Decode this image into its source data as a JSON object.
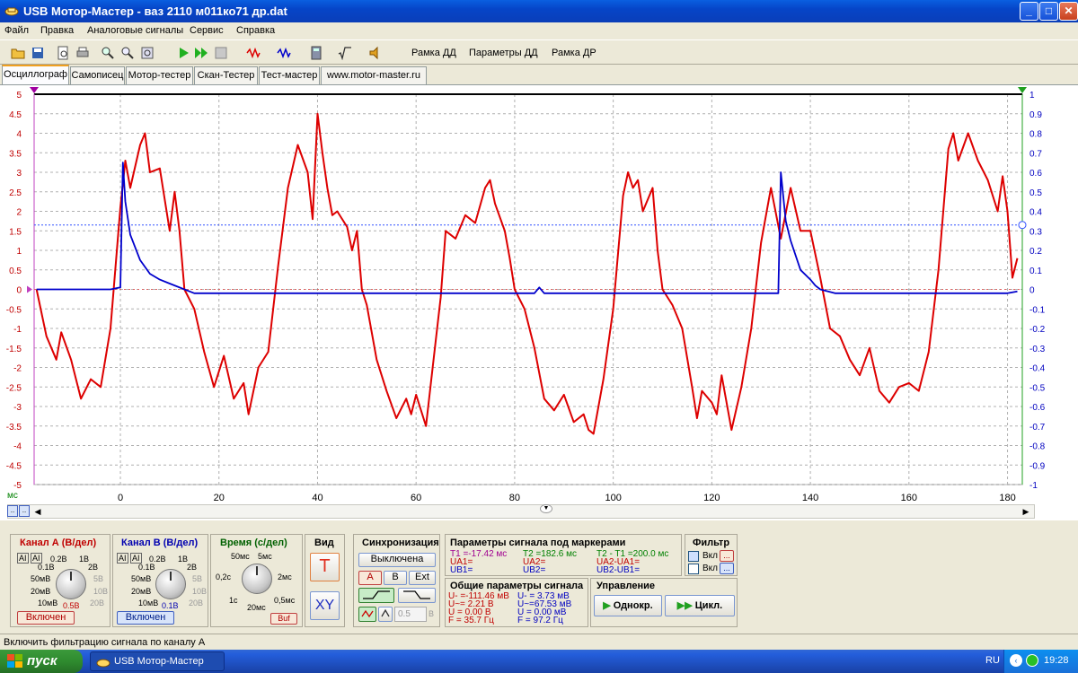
{
  "window": {
    "title": "USB Мотор-Мастер - ваз 2110 м011ко71 др.dat",
    "minimize": "_",
    "maximize": "□",
    "close": "✕"
  },
  "menu": [
    "Файл",
    "Правка",
    "Аналоговые сигналы",
    "Сервис",
    "Справка"
  ],
  "toolbar": {
    "buttons": [
      "Рамка ДД",
      "Параметры ДД",
      "Рамка ДР"
    ],
    "icons": [
      "open-folder-icon",
      "save-icon",
      "preview-icon",
      "print-icon",
      "zoom-in-icon",
      "zoom-out-icon",
      "zoom-fit-icon",
      "play-icon",
      "fast-forward-icon",
      "stop-icon",
      "signal-a-icon",
      "signal-b-icon",
      "calculator-icon",
      "sqrt-icon",
      "sound-icon"
    ]
  },
  "tabs": [
    "Осциллограф",
    "Самописец",
    "Мотор-тестер",
    "Скан-Тестер",
    "Тест-мастер",
    "www.motor-master.ru"
  ],
  "active_tab": 0,
  "chart_data": {
    "type": "line",
    "xlabel": "мс",
    "xlim": [
      -17.5,
      183
    ],
    "x_ticks": [
      0,
      20,
      40,
      60,
      80,
      100,
      120,
      140,
      160,
      180
    ],
    "ylim_left": [
      -5,
      5
    ],
    "y_ticks_left": [
      5,
      4.5,
      4,
      3.5,
      3,
      2.5,
      2,
      1.5,
      1,
      0.5,
      0,
      -0.5,
      -1,
      -1.5,
      -2,
      -2.5,
      -3,
      -3.5,
      -4,
      -4.5,
      -5
    ],
    "y_ticks_left_labels": [
      "5",
      "4.5",
      "4",
      "3.5",
      "3",
      "2.5",
      "2",
      "1.5",
      "1",
      "0.5",
      "0",
      "-0.5",
      "-1",
      "-1.5",
      "-2",
      "-2.5",
      "-3",
      "-3.5",
      "-4",
      "-4.5",
      "-5"
    ],
    "ylim_right": [
      -1,
      1
    ],
    "y_ticks_right_labels": [
      "1",
      "0.9",
      "0.8",
      "0.7",
      "0.6",
      "0.5",
      "0.4",
      "0.3",
      "0.2",
      "0.1",
      "0",
      "-0.1",
      "-0.2",
      "-0.3",
      "-0.4",
      "-0.5",
      "-0.6",
      "-0.7",
      "-0.8",
      "-0.9",
      "-1"
    ],
    "grid": true,
    "marker_level_right": 0.33,
    "series": [
      {
        "color": "#dd0000",
        "axis": "left",
        "x": [
          -17,
          -15,
          -13,
          -12,
          -10,
          -8,
          -6,
          -4,
          -2,
          0,
          1,
          2,
          4,
          5,
          6,
          8,
          10,
          11,
          12,
          13,
          15,
          17,
          19,
          21,
          23,
          25,
          26,
          28,
          30,
          32,
          34,
          36,
          38,
          39,
          40,
          41,
          42,
          43,
          44,
          46,
          47,
          48,
          49,
          50,
          52,
          54,
          56,
          58,
          59,
          60,
          62,
          64,
          65,
          66,
          68,
          70,
          72,
          74,
          75,
          76,
          78,
          79,
          80,
          82,
          84,
          86,
          88,
          90,
          92,
          94,
          95,
          96,
          98,
          100,
          102,
          103,
          104,
          105,
          106,
          108,
          109,
          110,
          112,
          114,
          116,
          117,
          118,
          120,
          121,
          122,
          124,
          126,
          128,
          130,
          132,
          134,
          136,
          138,
          140,
          142,
          144,
          146,
          148,
          150,
          152,
          154,
          156,
          158,
          160,
          162,
          164,
          166,
          168,
          169,
          170,
          172,
          174,
          176,
          178,
          179,
          180,
          181,
          182
        ],
        "y": [
          0,
          -1.2,
          -1.8,
          -1.1,
          -1.8,
          -2.8,
          -2.3,
          -2.5,
          -1,
          2.1,
          3.3,
          2.6,
          3.7,
          4,
          3,
          3.1,
          1.5,
          2.5,
          1.5,
          0,
          -0.5,
          -1.6,
          -2.5,
          -1.7,
          -2.8,
          -2.4,
          -3.2,
          -2,
          -1.6,
          0.6,
          2.6,
          3.7,
          3,
          1.8,
          4.5,
          3.5,
          2.6,
          1.9,
          2,
          1.6,
          1,
          1.5,
          0,
          -0.4,
          -1.8,
          -2.6,
          -3.3,
          -2.8,
          -3.2,
          -2.7,
          -3.5,
          -1.3,
          -0.2,
          1.5,
          1.3,
          1.9,
          1.7,
          2.6,
          2.8,
          2.2,
          1.5,
          0.8,
          0,
          -0.5,
          -1.5,
          -2.8,
          -3.1,
          -2.7,
          -3.4,
          -3.2,
          -3.6,
          -3.7,
          -2.3,
          -0.5,
          2.4,
          3,
          2.6,
          2.8,
          2,
          2.6,
          1,
          0,
          -0.4,
          -1,
          -2.5,
          -3.3,
          -2.6,
          -2.9,
          -3.2,
          -2.2,
          -3.6,
          -2.5,
          -1,
          1.2,
          2.6,
          1.3,
          2.6,
          1.5,
          1.5,
          0.3,
          -1,
          -1.2,
          -1.8,
          -2.2,
          -1.5,
          -2.6,
          -2.9,
          -2.5,
          -2.4,
          -2.6,
          -1.6,
          0.5,
          3.6,
          4,
          3.3,
          4,
          3.3,
          2.8,
          2,
          2.9,
          2,
          0.3,
          0.8
        ]
      },
      {
        "color": "#0000cc",
        "axis": "right",
        "x": [
          -17,
          -15,
          -10,
          -5,
          -2,
          0,
          0.5,
          1,
          2,
          4,
          6,
          8,
          10,
          15,
          20,
          40,
          60,
          84,
          85,
          86,
          100,
          120,
          132,
          133.5,
          134,
          135,
          136,
          138,
          140,
          141,
          142,
          145,
          150,
          160,
          170,
          180,
          182
        ],
        "y": [
          0,
          0,
          0,
          0,
          0,
          0.01,
          0.65,
          0.45,
          0.28,
          0.15,
          0.08,
          0.05,
          0.03,
          -0.02,
          -0.02,
          -0.02,
          -0.02,
          -0.02,
          0.01,
          -0.02,
          -0.02,
          -0.02,
          -0.02,
          -0.02,
          0.6,
          0.35,
          0.25,
          0.1,
          0.05,
          0.02,
          0.0,
          -0.02,
          -0.02,
          -0.02,
          -0.02,
          -0.02,
          -0.01
        ]
      }
    ]
  },
  "channel_a": {
    "title": "Канал А (В/дел)",
    "scales": [
      "0.1В",
      "0.2В",
      "1В",
      "2В",
      "5В",
      "10В",
      "20В",
      "0.5В",
      "10мВ",
      "20мВ",
      "50мВ"
    ],
    "selected": "0.5В",
    "button": "Включен",
    "ai_badges": [
      "AI",
      "AI"
    ]
  },
  "channel_b": {
    "title": "Канал В (В/дел)",
    "scales": [
      "0.1В",
      "0.2В",
      "1В",
      "2В",
      "5В",
      "10В",
      "20В",
      "0.1В",
      "10мВ",
      "20мВ",
      "50мВ"
    ],
    "selected": "0.1В",
    "button": "Включен",
    "ai_badges": [
      "AI",
      "AI"
    ]
  },
  "time": {
    "title": "Время (с/дел)",
    "scales": [
      "50мс",
      "0,2с",
      "1с",
      "20мс",
      "0,5мс",
      "2мс",
      "5мс"
    ],
    "button": "Buf"
  },
  "view": {
    "title": "Вид",
    "t_button": "T",
    "xy_button": "XY"
  },
  "sync": {
    "title": "Синхронизация",
    "mode_button": "Выключена",
    "channels": [
      "A",
      "B",
      "Ext"
    ],
    "level_value": "0.5",
    "level_unit": "В"
  },
  "marker_params": {
    "title": "Параметры сигнала под маркерами",
    "t1": "T1 =-17.42 мс",
    "t2": "T2 =182.6 мс",
    "dt": "T2 - T1 =200.0 мс",
    "ua1": "UA1=",
    "ua2": "UA2=",
    "dua": "UA2-UA1=",
    "ub1": "UB1=",
    "ub2": "UB2=",
    "dub": "UB2-UB1="
  },
  "general_params": {
    "title": "Общие параметры сигнала",
    "col_a": [
      "U- =-111.46 мВ",
      "U~= 2.21 В",
      "U = 0.00 В",
      "F = 35.7 Гц"
    ],
    "col_b": [
      "U- = 3.73 мВ",
      "U~=67.53 мВ",
      "U = 0.00 мВ",
      "F = 97.2 Гц"
    ]
  },
  "filter": {
    "title": "Фильтр",
    "a_label": "Вкл",
    "b_label": "Вкл",
    "more": "..."
  },
  "control": {
    "title": "Управление",
    "single_button": "Однокр.",
    "cycle_button": "Цикл."
  },
  "status_text": "Включить фильтрацию сигнала по каналу А",
  "taskbar": {
    "start": "пуск",
    "task": "USB Мотор-Мастер",
    "lang": "RU",
    "clock": "19:28"
  }
}
